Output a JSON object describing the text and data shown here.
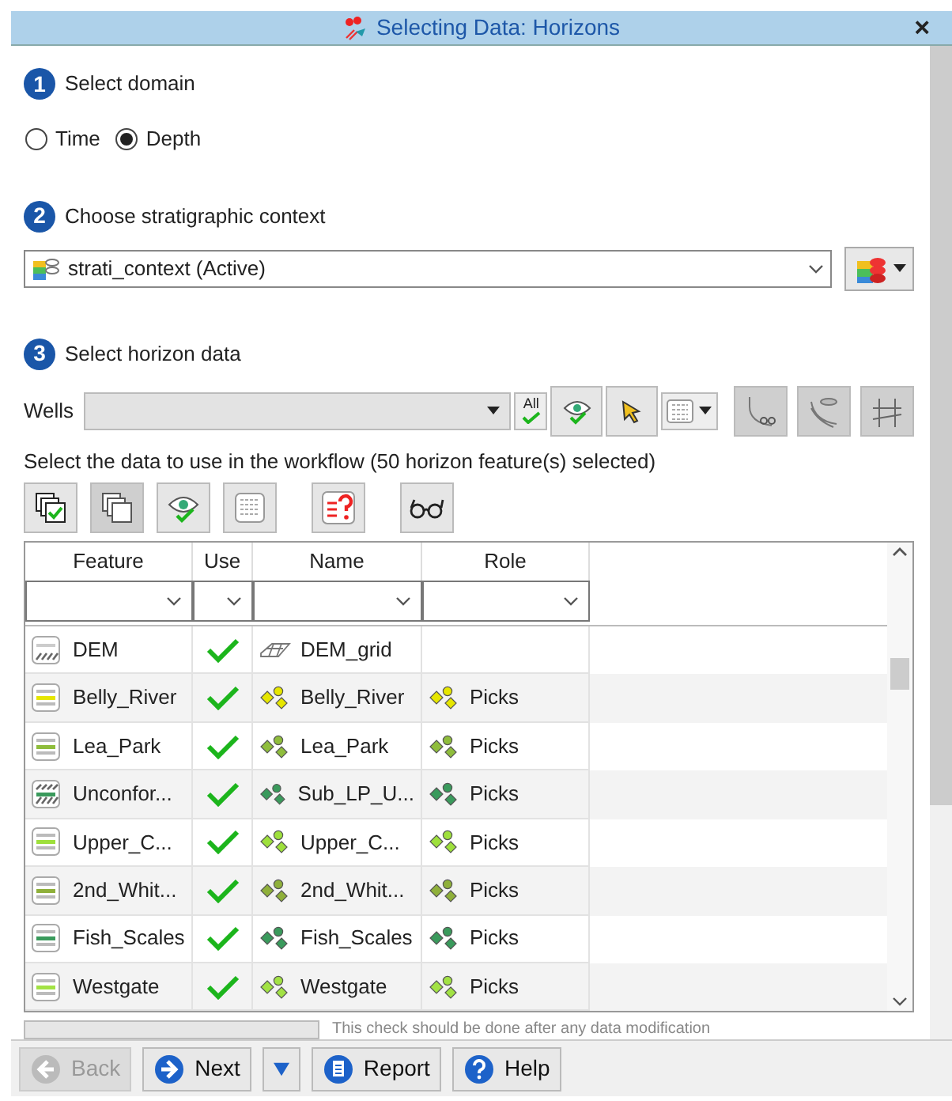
{
  "window": {
    "title": "Selecting Data: Horizons",
    "close": "×"
  },
  "steps": [
    {
      "number": "1",
      "label": "Select domain"
    },
    {
      "number": "2",
      "label": "Choose stratigraphic context"
    },
    {
      "number": "3",
      "label": "Select horizon data"
    }
  ],
  "domain": [
    {
      "label": "Time",
      "selected": false
    },
    {
      "label": "Depth",
      "selected": true
    }
  ],
  "context": {
    "value": "strati_context (Active)"
  },
  "wells": {
    "label": "Wells",
    "all_label": "All"
  },
  "selection_text": "Select the data to use in the workflow (50 horizon feature(s) selected)",
  "table": {
    "columns": [
      "Feature",
      "Use",
      "Name",
      "Role"
    ],
    "rows": [
      {
        "feature": {
          "text": "DEM",
          "kind": "grid"
        },
        "use": true,
        "name": {
          "text": "DEM_grid",
          "kind": "grid"
        }
      },
      {
        "feature": {
          "text": "Belly_River",
          "kind": "horizon",
          "color": "#e6e600"
        },
        "use": true,
        "name": {
          "text": "Belly_River",
          "kind": "picks"
        },
        "role": {
          "text": "Picks"
        }
      },
      {
        "feature": {
          "text": "Lea_Park",
          "kind": "horizon",
          "color": "#8fbd3c"
        },
        "use": true,
        "name": {
          "text": "Lea_Park",
          "kind": "picks"
        },
        "role": {
          "text": "Picks"
        }
      },
      {
        "feature": {
          "text": "Unconfor...",
          "kind": "unconformity",
          "color": "#3a9a5c"
        },
        "use": true,
        "name": {
          "text": "Sub_LP_U...",
          "kind": "picks"
        },
        "role": {
          "text": "Picks"
        }
      },
      {
        "feature": {
          "text": "Upper_C...",
          "kind": "horizon",
          "color": "#9ee03c"
        },
        "use": true,
        "name": {
          "text": "Upper_C...",
          "kind": "picks"
        },
        "role": {
          "text": "Picks"
        }
      },
      {
        "feature": {
          "text": "2nd_Whit...",
          "kind": "horizon",
          "color": "#8fb03a"
        },
        "use": true,
        "name": {
          "text": "2nd_Whit...",
          "kind": "picks"
        },
        "role": {
          "text": "Picks"
        }
      },
      {
        "feature": {
          "text": "Fish_Scales",
          "kind": "horizon",
          "color": "#3a9a5c"
        },
        "use": true,
        "name": {
          "text": "Fish_Scales",
          "kind": "picks"
        },
        "role": {
          "text": "Picks"
        }
      },
      {
        "feature": {
          "text": "Westgate",
          "kind": "horizon",
          "color": "#a2e244"
        },
        "use": true,
        "name": {
          "text": "Westgate",
          "kind": "picks"
        },
        "role": {
          "text": "Picks"
        }
      }
    ]
  },
  "note": "This check should be done after any data modification",
  "buttons": [
    {
      "label": "Back",
      "kind": "back",
      "disabled": true
    },
    {
      "label": "Next",
      "kind": "next",
      "disabled": false
    },
    {
      "kind": "menu",
      "disabled": false
    },
    {
      "label": "Report",
      "kind": "report",
      "disabled": false
    },
    {
      "label": "Help",
      "kind": "help",
      "disabled": false
    }
  ]
}
